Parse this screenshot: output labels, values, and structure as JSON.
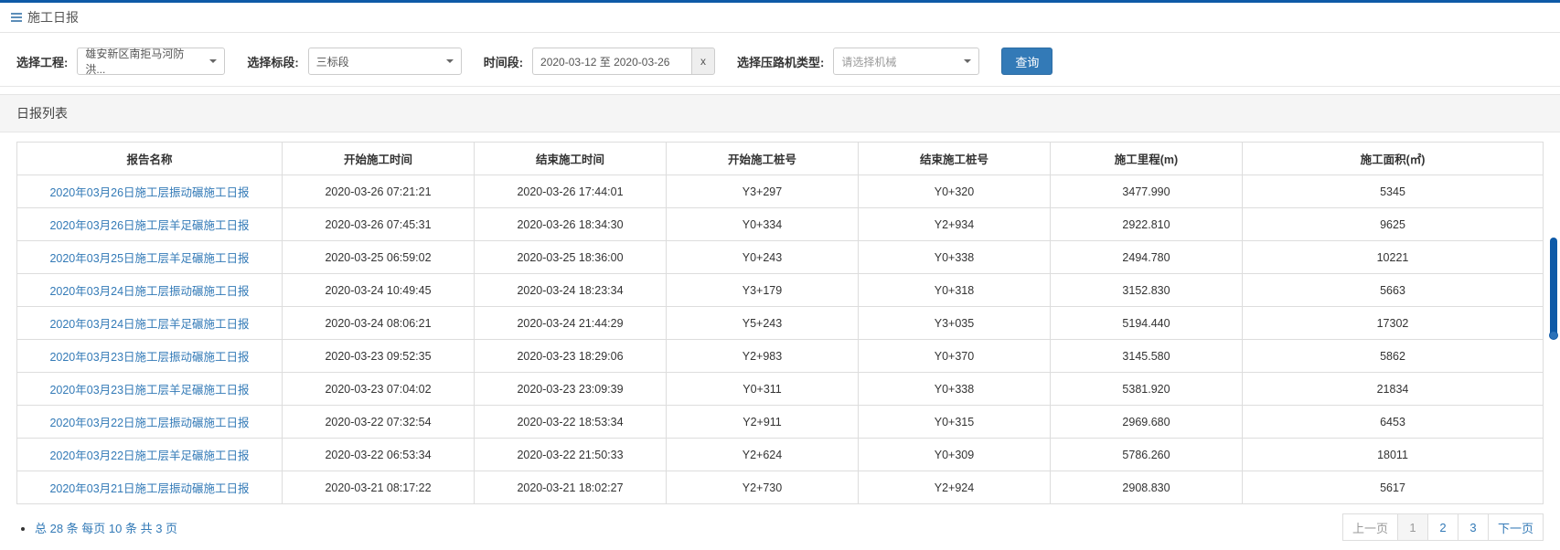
{
  "header": {
    "title": "施工日报"
  },
  "filter": {
    "project_label": "选择工程:",
    "project_value": "雄安新区南拒马河防洪...",
    "section_label": "选择标段:",
    "section_value": "三标段",
    "date_label": "时间段:",
    "date_value": "2020-03-12 至 2020-03-26",
    "clear_label": "x",
    "machine_label": "选择压路机类型:",
    "machine_placeholder": "请选择机械",
    "query_label": "查询"
  },
  "section_title": "日报列表",
  "columns": {
    "c0": "报告名称",
    "c1": "开始施工时间",
    "c2": "结束施工时间",
    "c3": "开始施工桩号",
    "c4": "结束施工桩号",
    "c5": "施工里程(m)",
    "c6": "施工面积(㎡)"
  },
  "rows": [
    {
      "name": "2020年03月26日施工层振动碾施工日报",
      "start_time": "2020-03-26 07:21:21",
      "end_time": "2020-03-26 17:44:01",
      "start_pile": "Y3+297",
      "end_pile": "Y0+320",
      "mileage": "3477.990",
      "area": "5345"
    },
    {
      "name": "2020年03月26日施工层羊足碾施工日报",
      "start_time": "2020-03-26 07:45:31",
      "end_time": "2020-03-26 18:34:30",
      "start_pile": "Y0+334",
      "end_pile": "Y2+934",
      "mileage": "2922.810",
      "area": "9625"
    },
    {
      "name": "2020年03月25日施工层羊足碾施工日报",
      "start_time": "2020-03-25 06:59:02",
      "end_time": "2020-03-25 18:36:00",
      "start_pile": "Y0+243",
      "end_pile": "Y0+338",
      "mileage": "2494.780",
      "area": "10221"
    },
    {
      "name": "2020年03月24日施工层振动碾施工日报",
      "start_time": "2020-03-24 10:49:45",
      "end_time": "2020-03-24 18:23:34",
      "start_pile": "Y3+179",
      "end_pile": "Y0+318",
      "mileage": "3152.830",
      "area": "5663"
    },
    {
      "name": "2020年03月24日施工层羊足碾施工日报",
      "start_time": "2020-03-24 08:06:21",
      "end_time": "2020-03-24 21:44:29",
      "start_pile": "Y5+243",
      "end_pile": "Y3+035",
      "mileage": "5194.440",
      "area": "17302"
    },
    {
      "name": "2020年03月23日施工层振动碾施工日报",
      "start_time": "2020-03-23 09:52:35",
      "end_time": "2020-03-23 18:29:06",
      "start_pile": "Y2+983",
      "end_pile": "Y0+370",
      "mileage": "3145.580",
      "area": "5862"
    },
    {
      "name": "2020年03月23日施工层羊足碾施工日报",
      "start_time": "2020-03-23 07:04:02",
      "end_time": "2020-03-23 23:09:39",
      "start_pile": "Y0+311",
      "end_pile": "Y0+338",
      "mileage": "5381.920",
      "area": "21834"
    },
    {
      "name": "2020年03月22日施工层振动碾施工日报",
      "start_time": "2020-03-22 07:32:54",
      "end_time": "2020-03-22 18:53:34",
      "start_pile": "Y2+911",
      "end_pile": "Y0+315",
      "mileage": "2969.680",
      "area": "6453"
    },
    {
      "name": "2020年03月22日施工层羊足碾施工日报",
      "start_time": "2020-03-22 06:53:34",
      "end_time": "2020-03-22 21:50:33",
      "start_pile": "Y2+624",
      "end_pile": "Y0+309",
      "mileage": "5786.260",
      "area": "18011"
    },
    {
      "name": "2020年03月21日施工层振动碾施工日报",
      "start_time": "2020-03-21 08:17:22",
      "end_time": "2020-03-21 18:02:27",
      "start_pile": "Y2+730",
      "end_pile": "Y2+924",
      "mileage": "2908.830",
      "area": "5617"
    }
  ],
  "pagination": {
    "summary": "总 28 条  每页 10 条  共 3 页",
    "prev": "上一页",
    "pages": [
      "1",
      "2",
      "3"
    ],
    "next": "下一页",
    "current": 1
  }
}
